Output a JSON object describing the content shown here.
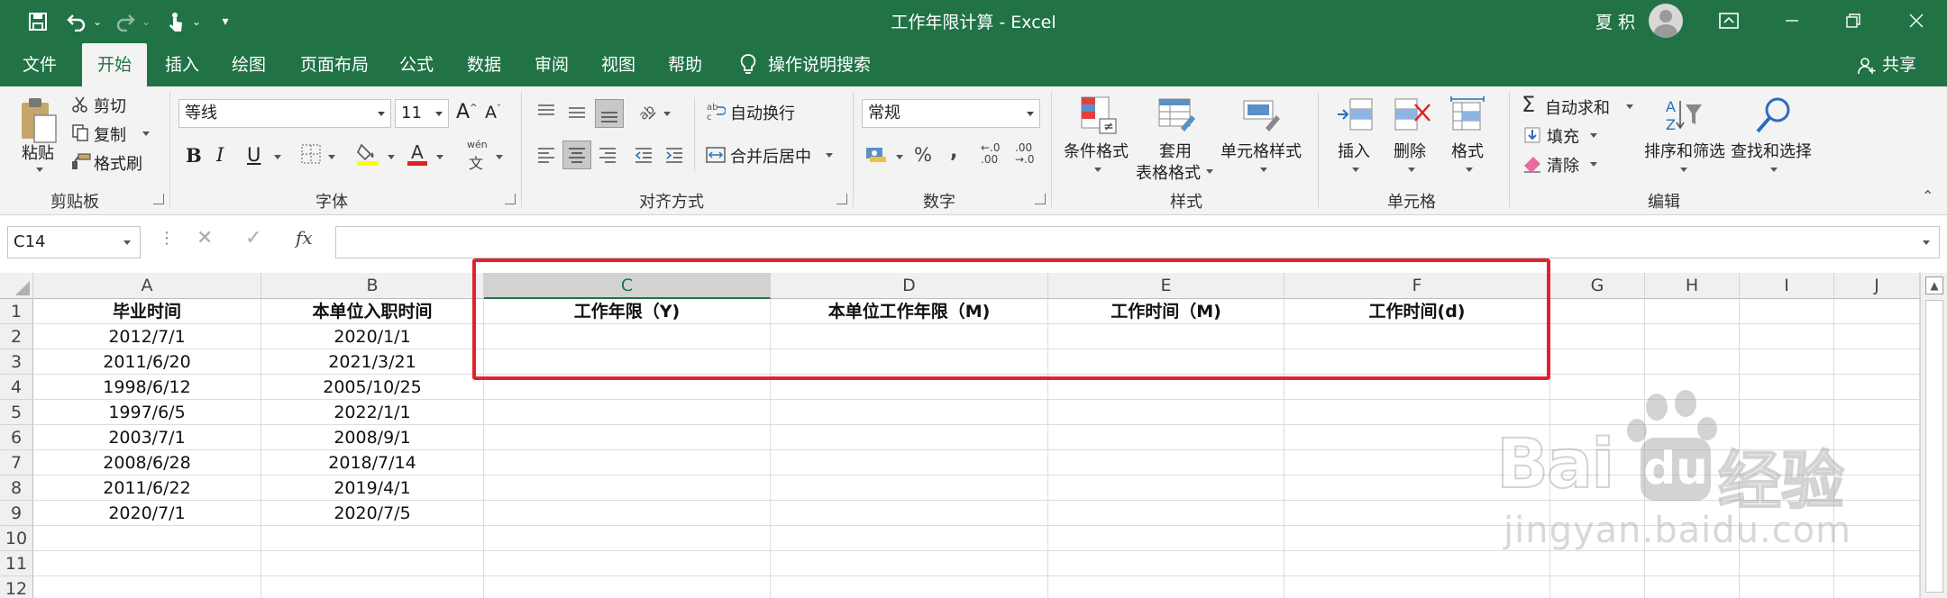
{
  "window": {
    "title": "工作年限计算 - Excel",
    "user_name": "夏 积"
  },
  "menu": {
    "tabs": [
      "文件",
      "开始",
      "插入",
      "绘图",
      "页面布局",
      "公式",
      "数据",
      "审阅",
      "视图",
      "帮助",
      "操作说明搜索"
    ],
    "active_tab": "开始",
    "share": "共享"
  },
  "ribbon": {
    "clipboard": {
      "paste": "粘贴",
      "cut": "剪切",
      "copy": "复制",
      "format_painter": "格式刷",
      "group": "剪贴板"
    },
    "font": {
      "family": "等线",
      "size": "11",
      "bold": "B",
      "italic": "I",
      "underline": "U",
      "pinyin": "wén",
      "group": "字体"
    },
    "alignment": {
      "wrap_text": "自动换行",
      "merge_center": "合并后居中",
      "group": "对齐方式"
    },
    "number": {
      "format": "常规",
      "group": "数字"
    },
    "styles": {
      "conditional": "条件格式",
      "table_1": "套用",
      "table_2": "表格格式",
      "cell_styles": "单元格样式",
      "group": "样式"
    },
    "cells": {
      "insert": "插入",
      "delete": "删除",
      "format": "格式",
      "group": "单元格"
    },
    "editing": {
      "autosum": "自动求和",
      "fill": "填充",
      "clear": "清除",
      "sort_filter": "排序和筛选",
      "find_select": "查找和选择",
      "group": "编辑"
    }
  },
  "formula_bar": {
    "name_box": "C14",
    "fx": "fx",
    "formula": ""
  },
  "sheet": {
    "columns": [
      "A",
      "B",
      "C",
      "D",
      "E",
      "F",
      "G",
      "H",
      "I",
      "J"
    ],
    "selected_column": "C",
    "rows": [
      "1",
      "2",
      "3",
      "4",
      "5",
      "6",
      "7",
      "8",
      "9",
      "10",
      "11",
      "12"
    ],
    "headers": [
      "毕业时间",
      "本单位入职时间",
      "工作年限（Y)",
      "本单位工作年限（M)",
      "工作时间（M)",
      "工作时间(d)"
    ],
    "data": [
      [
        "2012/7/1",
        "2020/1/1"
      ],
      [
        "2011/6/20",
        "2021/3/21"
      ],
      [
        "1998/6/12",
        "2005/10/25"
      ],
      [
        "1997/6/5",
        "2022/1/1"
      ],
      [
        "2003/7/1",
        "2008/9/1"
      ],
      [
        "2008/6/28",
        "2018/7/14"
      ],
      [
        "2011/6/22",
        "2019/4/1"
      ],
      [
        "2020/7/1",
        "2020/7/5"
      ]
    ]
  },
  "watermark": {
    "brand": "Bai",
    "brand2": "du",
    "cn": "经验",
    "url": "jingyan.baidu.com"
  },
  "colors": {
    "excel_green": "#217346",
    "highlight_red": "#e0232e"
  }
}
